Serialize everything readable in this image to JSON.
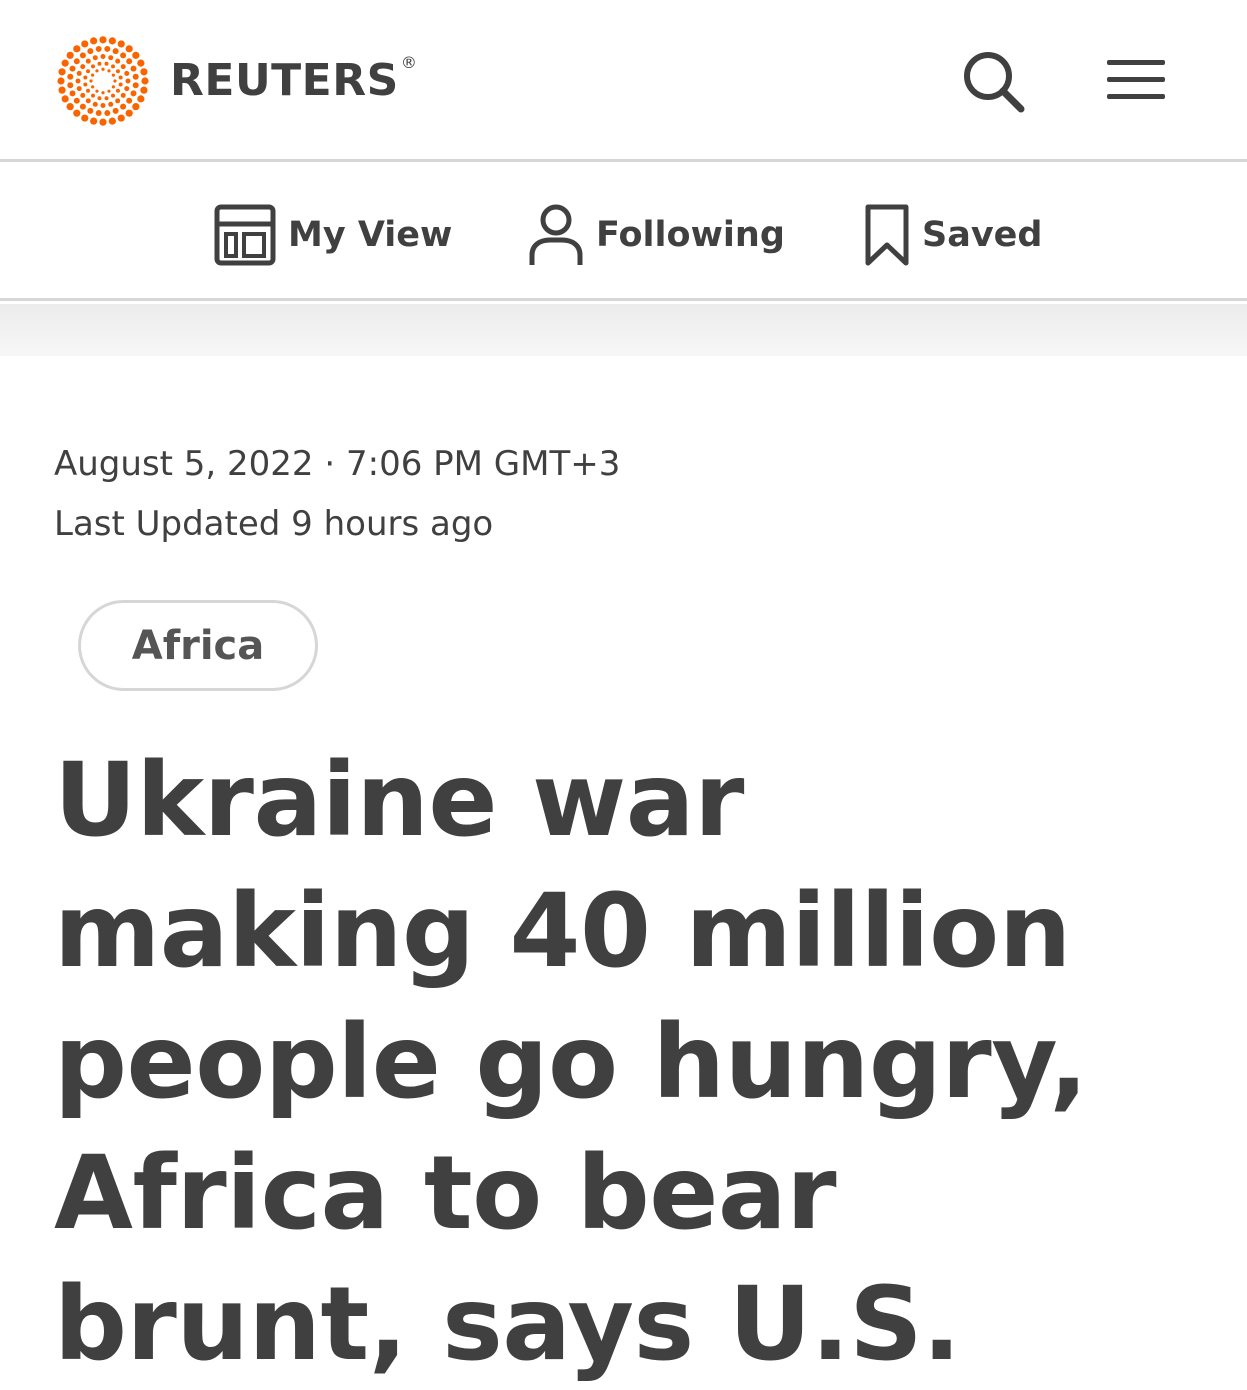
{
  "header": {
    "brand": "REUTERS",
    "registered_mark": "®",
    "brand_color": "#fa6400",
    "search_icon": "search-icon",
    "menu_icon": "hamburger-menu-icon"
  },
  "subnav": {
    "items": [
      {
        "label": "My View",
        "icon": "layout-grid-icon"
      },
      {
        "label": "Following",
        "icon": "person-icon"
      },
      {
        "label": "Saved",
        "icon": "bookmark-icon"
      }
    ]
  },
  "article": {
    "dateline": "August 5, 2022 · 7:06 PM GMT+3",
    "updated": "Last Updated 9 hours ago",
    "tag": "Africa",
    "headline": "Ukraine war making 40 million people go hungry, Africa to bear brunt, says U.S."
  }
}
